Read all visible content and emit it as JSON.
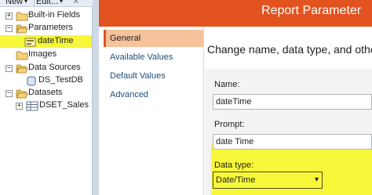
{
  "toolbar": {
    "new_label": "New",
    "edit_label": "Edit...",
    "dropdown_glyph": "▾",
    "delete_glyph": "✕"
  },
  "tree": {
    "items": [
      {
        "label": "Built-in Fields",
        "expander": "+",
        "icon": "folder-icon"
      },
      {
        "label": "Parameters",
        "expander": "−",
        "icon": "folder-open-icon"
      },
      {
        "label": "dateTime",
        "icon": "parameter-icon",
        "selected": true
      },
      {
        "label": "Images",
        "icon": "folder-icon"
      },
      {
        "label": "Data Sources",
        "expander": "−",
        "icon": "folder-open-icon"
      },
      {
        "label": "DS_TestDB",
        "icon": "data-source-icon"
      },
      {
        "label": "Datasets",
        "expander": "−",
        "icon": "folder-open-icon"
      },
      {
        "label": "DSET_Sales",
        "icon": "dataset-icon"
      }
    ]
  },
  "dialog": {
    "title": "Report Parameter",
    "header_text": "Change name, data type, and other c",
    "nav": [
      {
        "label": "General",
        "active": true
      },
      {
        "label": "Available Values"
      },
      {
        "label": "Default Values"
      },
      {
        "label": "Advanced"
      }
    ],
    "name_label": "Name:",
    "name_value": "dateTime",
    "prompt_label": "Prompt:",
    "prompt_value": "date Time",
    "data_type_label": "Data type:",
    "data_type_value": "Date/Time",
    "select_arrow": "▾"
  },
  "colors": {
    "title_bar": "#e2531f",
    "nav_active": "#f6c29b",
    "highlight": "#f8f83a",
    "selection": "#f6f63a"
  }
}
